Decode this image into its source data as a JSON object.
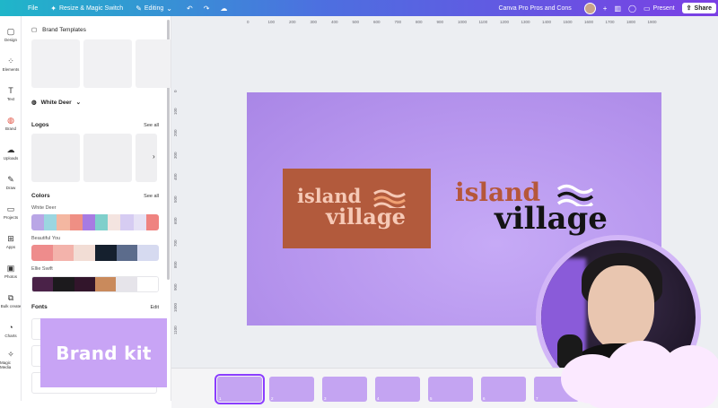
{
  "topbar": {
    "file_label": "File",
    "resize_label": "Resize & Magic Switch",
    "editing_label": "Editing",
    "doc_title": "Canva Pro Pros and Cons",
    "present_label": "Present",
    "share_label": "Share"
  },
  "rail": {
    "items": [
      {
        "label": "Design",
        "icon": "▢"
      },
      {
        "label": "Elements",
        "icon": "⁘"
      },
      {
        "label": "Text",
        "icon": "T"
      },
      {
        "label": "Brand",
        "icon": "◍"
      },
      {
        "label": "Uploads",
        "icon": "☁"
      },
      {
        "label": "Draw",
        "icon": "✎"
      },
      {
        "label": "Projects",
        "icon": "▭"
      },
      {
        "label": "Apps",
        "icon": "⊞"
      },
      {
        "label": "Photos",
        "icon": "▣"
      },
      {
        "label": "Bulk create",
        "icon": "⧉"
      },
      {
        "label": "Charts",
        "icon": "◔"
      },
      {
        "label": "Magic Media",
        "icon": "✧"
      }
    ]
  },
  "panel": {
    "header": "Brand Templates",
    "brand_name": "White Deer",
    "logos_label": "Logos",
    "logos_see_all": "See all",
    "colors_label": "Colors",
    "colors_see_all": "See all",
    "palettes": [
      {
        "name": "White Deer",
        "colors": [
          "#b9a6e6",
          "#9bd6e0",
          "#f4b7a1",
          "#ef8f84",
          "#a77be2",
          "#7fcfcb",
          "#f4e4e0",
          "#d6ccf2",
          "#e6e2f5",
          "#ef8380"
        ]
      },
      {
        "name": "Beautiful You",
        "colors": [
          "#ee8c8c",
          "#f3b3ab",
          "#f2ddd5",
          "#15202e",
          "#5c6c8c",
          "#d6daf0"
        ]
      },
      {
        "name": "Ellie Swift",
        "colors": [
          "#4a2248",
          "#1c1a1d",
          "#32152b",
          "#c98a5c",
          "#e6e4ea",
          "#ffffff"
        ]
      }
    ],
    "fonts_label": "Fonts",
    "fonts_edit": "Edit"
  },
  "overlay": {
    "brand_kit_text": "Brand kit"
  },
  "ruler": {
    "top": [
      "0",
      "100",
      "200",
      "300",
      "400",
      "500",
      "600",
      "700",
      "800",
      "900",
      "1000",
      "1100",
      "1200",
      "1300",
      "1400",
      "1500",
      "1600",
      "1700",
      "1800",
      "1900"
    ],
    "left": [
      "0",
      "100",
      "200",
      "300",
      "400",
      "500",
      "600",
      "700",
      "800",
      "900",
      "1000",
      "1100"
    ]
  },
  "slide": {
    "logo1_line1": "island",
    "logo1_line2": "village",
    "logo2_line1": "island",
    "logo2_line2": "village",
    "colors": {
      "bg": "#b796ee",
      "rect": "#b25a3c",
      "peach": "#f6c9b6",
      "rust": "#b5573a",
      "dark": "#141414"
    }
  },
  "filmstrip": {
    "pages": [
      "1",
      "2",
      "3",
      "4",
      "5",
      "6",
      "7"
    ]
  }
}
